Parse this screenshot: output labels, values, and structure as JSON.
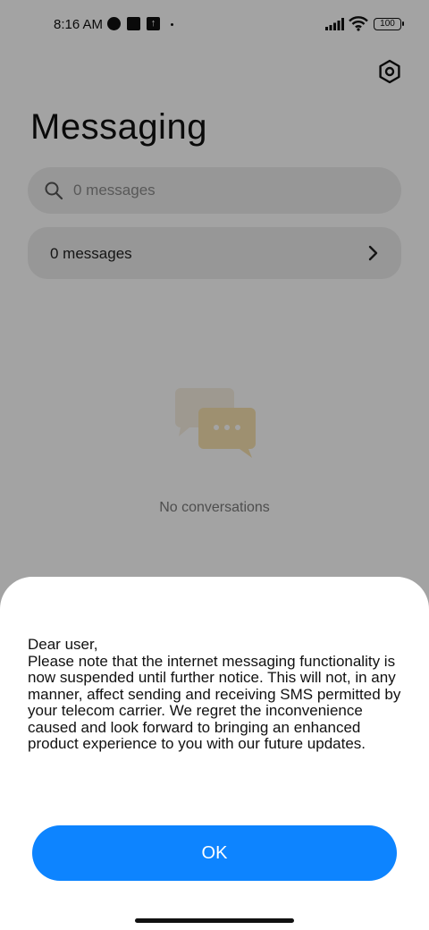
{
  "status_bar": {
    "time": "8:16 AM",
    "battery": "100"
  },
  "header": {
    "title": "Messaging",
    "settings_icon": "gear-icon"
  },
  "search": {
    "placeholder": "0 messages",
    "icon": "search-icon"
  },
  "messages_row": {
    "label": "0 messages",
    "icon": "chevron-right-icon"
  },
  "empty_state": {
    "text": "No conversations",
    "icon": "chat-bubbles-icon"
  },
  "dialog": {
    "message": "Dear user,\nPlease note that the internet messaging functionality is now suspended until further notice. This will not, in any manner, affect sending and receiving SMS permitted by your telecom carrier. We regret the inconvenience caused and look forward to bringing an enhanced product experience to you with our future updates.",
    "ok_label": "OK"
  },
  "colors": {
    "accent": "#0d84ff",
    "overlay": "rgba(0,0,0,0.36)"
  }
}
